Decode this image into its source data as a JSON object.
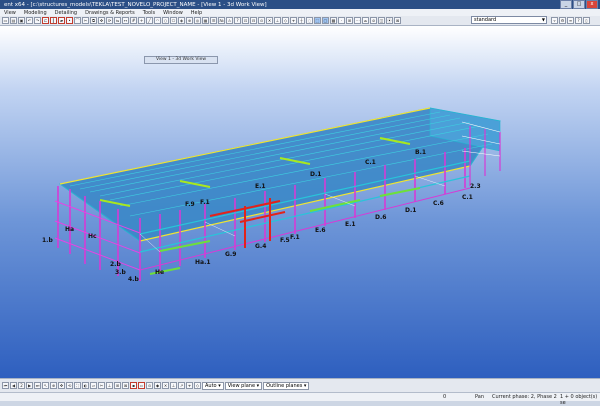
{
  "window": {
    "title": "ent x64 - [c:\\structures_models\\TEKLA\\TEST_NOVELO_PROJECT_NAME - [View 1 - 3d Work View]",
    "controls": [
      "_",
      "□",
      "x"
    ]
  },
  "menu": {
    "items": [
      "View",
      "Modeling",
      "Detailing",
      "Drawings & Reports",
      "Tools",
      "Window",
      "Help"
    ]
  },
  "toolbar": {
    "view_combo": "standard"
  },
  "viewport": {
    "view_title": "View 1 - 3d Work View",
    "grid_labels_front": [
      "1.b",
      "2.b",
      "3.b",
      "4.b",
      "5.b",
      "Ha",
      "Hc",
      "He",
      "Ha.1",
      "G.9",
      "G.4",
      "F.5",
      "F.1",
      "E.6",
      "E.1",
      "D.6",
      "D.1",
      "C.6",
      "C.1",
      "2.3"
    ],
    "grid_labels_roof": [
      "F.9",
      "F.1",
      "E.1",
      "D.1",
      "C.1",
      "B.1"
    ],
    "grid_labels_left": [
      "Ha",
      "Hc",
      "He",
      "Ha",
      "Hc"
    ]
  },
  "bottom_toolbar": {
    "page_number": "2",
    "snap_mode": "Auto",
    "plane": "View plane",
    "outline": "Outline planes"
  },
  "status": {
    "count": "0",
    "pan": "Pan",
    "phase": "Current phase: 2, Phase 2",
    "selection": "1 + 0 object(s) se"
  }
}
